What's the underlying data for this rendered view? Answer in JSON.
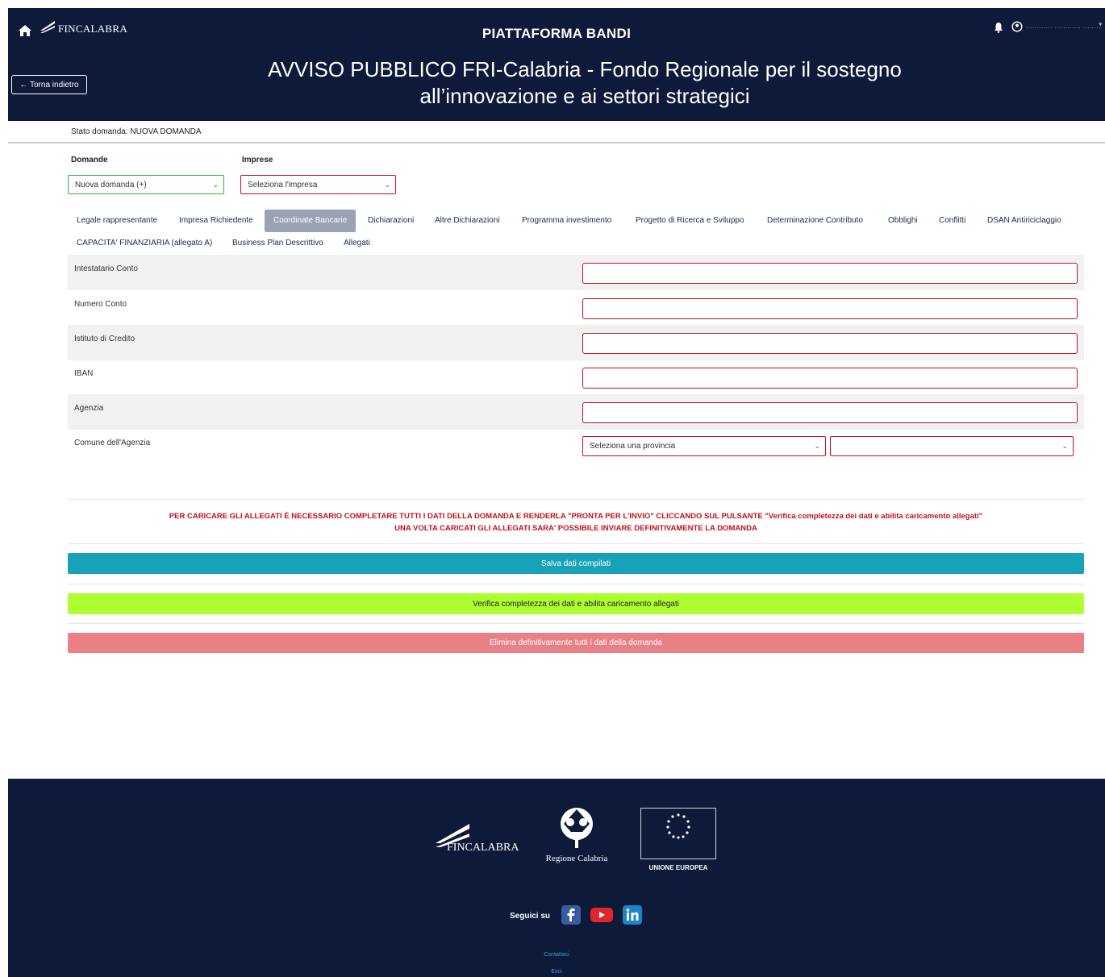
{
  "header": {
    "brand": "FINCALABRA",
    "app_title": "PIATTAFORMA BANDI",
    "bando_title": "AVVISO PUBBLICO FRI-Calabria - Fondo Regionale per il sostegno all’innovazione e ai settori strategici",
    "back_label": "← Torna indietro",
    "user_name": "............ ............ .........",
    "icons": [
      "home-icon",
      "bell-icon",
      "user-icon",
      "chevron-down-icon"
    ]
  },
  "status": {
    "text": "Stato domanda: NUOVA DOMANDA"
  },
  "selectors": {
    "domande_label": "Domande",
    "domande_value": "Nuova domanda (+)",
    "imprese_label": "Imprese",
    "imprese_value": "Seleziona l'impresa"
  },
  "tabs": [
    {
      "label": "Legale rappresentante",
      "active": false
    },
    {
      "label": "Impresa Richiedente",
      "active": false
    },
    {
      "label": "Coordinate Bancarie",
      "active": true
    },
    {
      "label": "Dichiarazioni",
      "active": false
    },
    {
      "label": "Altre Dichiarazioni",
      "active": false
    },
    {
      "label": "Programma investimento",
      "active": false
    },
    {
      "label": "Progetto di Ricerca e Sviluppo",
      "active": false
    },
    {
      "label": "Determinazione Contributo",
      "active": false
    },
    {
      "label": "Obblighi",
      "active": false
    },
    {
      "label": "Conflitti",
      "active": false
    },
    {
      "label": "DSAN Antiriciclaggio",
      "active": false
    },
    {
      "label": "CAPACITA' FINANZIARIA (allegato A)",
      "active": false
    },
    {
      "label": "Business Plan Descrittivo",
      "active": false
    },
    {
      "label": "Allegati",
      "active": false
    }
  ],
  "form": {
    "fields": [
      {
        "label": "Intestatario Conto",
        "value": ""
      },
      {
        "label": "Numero Conto",
        "value": ""
      },
      {
        "label": "Istituto di Credito",
        "value": ""
      },
      {
        "label": "IBAN",
        "value": ""
      },
      {
        "label": "Agenzia",
        "value": ""
      }
    ],
    "comune_label": "Comune dell'Agenzia",
    "provincia_placeholder": "Seleziona una provincia",
    "comune_value": ""
  },
  "warning": {
    "line1": "PER CARICARE GLI ALLEGATI È NECESSARIO COMPLETARE TUTTI I DATI DELLA DOMANDA E RENDERLA \"PRONTA PER L'INVIO\" CLICCANDO SUL PULSANTE \"Verifica completezza dei dati e abilita caricamento allegati\"",
    "line2": "UNA VOLTA CARICATI GLI ALLEGATI SARA' POSSIBILE INVIARE DEFINITIVAMENTE LA DOMANDA"
  },
  "actions": {
    "save": "Salva dati compilati",
    "verify": "Verifica completezza dei dati e abilita caricamento allegati",
    "delete": "Elimina definitivamente tutti i dati della domanda"
  },
  "colors": {
    "header_bg": "#0e1a3a",
    "invalid_border": "#c0121c",
    "valid_border": "#3cae3c",
    "save_btn": "#17a2b8",
    "verify_btn": "#adff2f",
    "delete_btn": "#e98086",
    "active_tab": "#9aa3b4"
  },
  "footer": {
    "fincalabra": "FINCALABRA",
    "regione": "Regione Calabria",
    "ue": "UNIONE EUROPEA",
    "follow_label": "Seguici su",
    "social_icons": [
      "facebook-icon",
      "youtube-icon",
      "linkedin-icon"
    ],
    "contatti": "Contattaci",
    "esci": "Esci"
  }
}
